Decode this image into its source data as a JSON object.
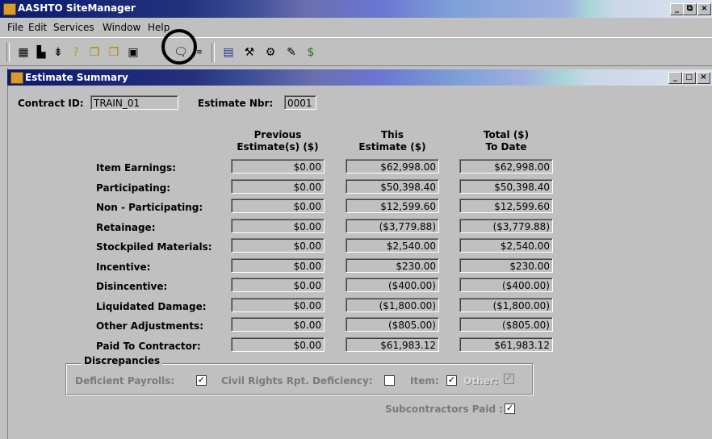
{
  "app": {
    "title": "AASHTO SiteManager"
  },
  "window_controls": {
    "minimize": "_",
    "restore": "⧉",
    "close": "×"
  },
  "menu": [
    "File",
    "Edit",
    "Services",
    "Window",
    "Help"
  ],
  "inner_window": {
    "title": "Estimate Summary"
  },
  "header": {
    "contract_label": "Contract ID:",
    "contract_value": "TRAIN_01",
    "estimate_label": "Estimate Nbr:",
    "estimate_value": "0001"
  },
  "columns": [
    {
      "line1": "Previous",
      "line2": "Estimate(s) ($)"
    },
    {
      "line1": "This",
      "line2": "Estimate ($)"
    },
    {
      "line1": "Total ($)",
      "line2": "To Date"
    }
  ],
  "rows": [
    {
      "label": "Item Earnings:",
      "values": [
        "$0.00",
        "$62,998.00",
        "$62,998.00"
      ]
    },
    {
      "label": "Participating:",
      "values": [
        "$0.00",
        "$50,398.40",
        "$50,398.40"
      ]
    },
    {
      "label": "Non - Participating:",
      "values": [
        "$0.00",
        "$12,599.60",
        "$12,599.60"
      ]
    },
    {
      "label": "Retainage:",
      "values": [
        "$0.00",
        "($3,779.88)",
        "($3,779.88)"
      ]
    },
    {
      "label": "Stockpiled Materials:",
      "values": [
        "$0.00",
        "$2,540.00",
        "$2,540.00"
      ]
    },
    {
      "label": "Incentive:",
      "values": [
        "$0.00",
        "$230.00",
        "$230.00"
      ]
    },
    {
      "label": "Disincentive:",
      "values": [
        "$0.00",
        "($400.00)",
        "($400.00)"
      ]
    },
    {
      "label": "Liquidated Damage:",
      "values": [
        "$0.00",
        "($1,800.00)",
        "($1,800.00)"
      ]
    },
    {
      "label": "Other Adjustments:",
      "values": [
        "$0.00",
        "($805.00)",
        "($805.00)"
      ]
    },
    {
      "label": "Paid To Contractor:",
      "values": [
        "$0.00",
        "$61,983.12",
        "$61,983.12"
      ]
    }
  ],
  "discrepancies": {
    "title": "Discrepancies",
    "deficient_payrolls": {
      "label": "Deficient Payrolls:",
      "checked": true
    },
    "civil_rights": {
      "label": "Civil Rights Rpt. Deficiency:",
      "checked": false
    },
    "item": {
      "label": "Item:",
      "checked": true
    },
    "other": {
      "label": "Other:",
      "checked": true
    }
  },
  "subcontractors": {
    "label": "Subcontractors Paid :",
    "checked": true
  },
  "toolbar_icons": [
    "table-icon",
    "save-db-icon",
    "dollar-icon",
    "help-icon",
    "folder-open-icon",
    "folder-open-icon",
    "save-icon",
    "comment-icon",
    "report-icon",
    "calendar-icon",
    "hammer-icon",
    "tool-icon",
    "pen-icon",
    "money-bag-icon"
  ],
  "colors": {
    "title_dark": "#0a1a6e",
    "face": "#c0c0c0"
  }
}
